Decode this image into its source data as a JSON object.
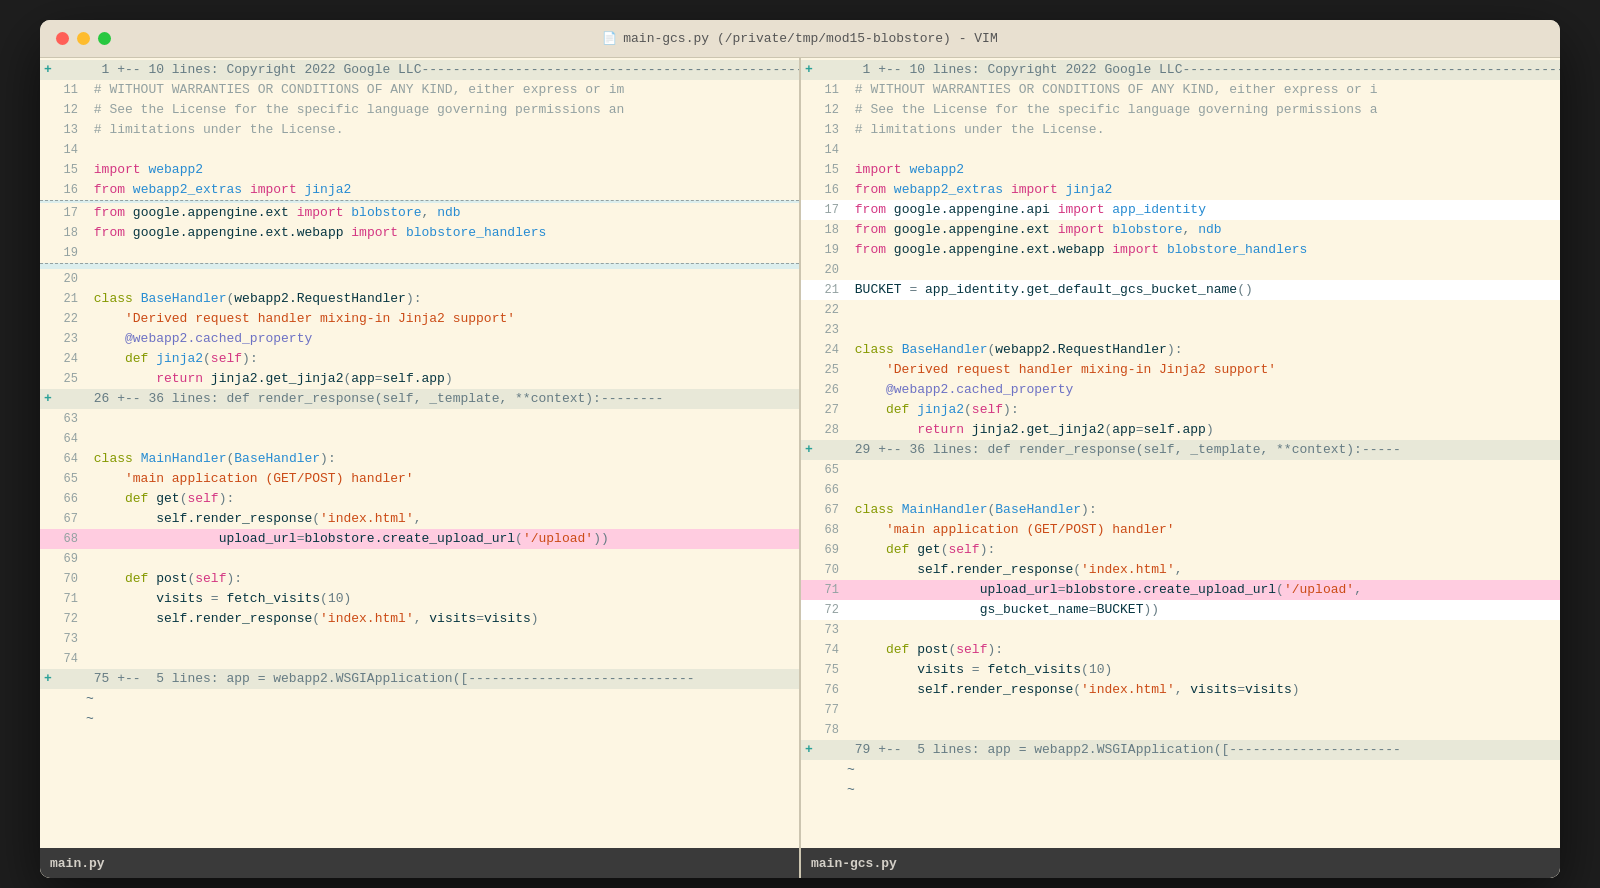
{
  "window": {
    "title": "main-gcs.py (/private/tmp/mod15-blobstore) - VIM",
    "title_icon": "📄"
  },
  "left_pane": {
    "statusbar_label": "main.py",
    "lines": [
      {
        "num": "",
        "fold": "+",
        "type": "fold",
        "content": "  1 +-- 10 lines: Copyright 2022 Google LLC------------------------------------------------------------"
      },
      {
        "num": "11",
        "fold": " ",
        "type": "comment",
        "content": " # WITHOUT WARRANTIES OR CONDITIONS OF ANY KIND, either express or im"
      },
      {
        "num": "12",
        "fold": " ",
        "type": "comment",
        "content": " # See the License for the specific language governing permissions an"
      },
      {
        "num": "13",
        "fold": " ",
        "type": "comment",
        "content": " # limitations under the License."
      },
      {
        "num": "14",
        "fold": " ",
        "type": "empty",
        "content": ""
      },
      {
        "num": "15",
        "fold": " ",
        "type": "normal",
        "content": " import webapp2"
      },
      {
        "num": "16",
        "fold": " ",
        "type": "normal",
        "content": " from webapp2_extras import jinja2"
      },
      {
        "num": "",
        "fold": " ",
        "type": "separator",
        "content": ""
      },
      {
        "num": "17",
        "fold": " ",
        "type": "normal",
        "content": " from google.appengine.ext import blobstore, ndb"
      },
      {
        "num": "18",
        "fold": " ",
        "type": "normal",
        "content": " from google.appengine.ext.webapp import blobstore_handlers"
      },
      {
        "num": "19",
        "fold": " ",
        "type": "empty",
        "content": ""
      },
      {
        "num": "",
        "fold": " ",
        "type": "separator",
        "content": ""
      },
      {
        "num": "",
        "fold": " ",
        "type": "separator2",
        "content": ""
      },
      {
        "num": "20",
        "fold": " ",
        "type": "empty",
        "content": ""
      },
      {
        "num": "21",
        "fold": " ",
        "type": "normal",
        "content": " class BaseHandler(webapp2.RequestHandler):"
      },
      {
        "num": "22",
        "fold": " ",
        "type": "normal",
        "content": "     'Derived request handler mixing-in Jinja2 support'"
      },
      {
        "num": "23",
        "fold": " ",
        "type": "normal",
        "content": "     @webapp2.cached_property"
      },
      {
        "num": "24",
        "fold": " ",
        "type": "normal",
        "content": "     def jinja2(self):"
      },
      {
        "num": "25",
        "fold": " ",
        "type": "normal",
        "content": "         return jinja2.get_jinja2(app=self.app)"
      },
      {
        "num": "",
        "fold": "+",
        "type": "fold",
        "content": " 26 +-- 36 lines: def render_response(self, _template, **context):--------"
      },
      {
        "num": "63",
        "fold": " ",
        "type": "empty",
        "content": ""
      },
      {
        "num": "64",
        "fold": " ",
        "type": "empty",
        "content": ""
      },
      {
        "num": "64",
        "fold": " ",
        "type": "normal",
        "content": " class MainHandler(BaseHandler):"
      },
      {
        "num": "65",
        "fold": " ",
        "type": "normal",
        "content": "     'main application (GET/POST) handler'"
      },
      {
        "num": "66",
        "fold": " ",
        "type": "normal",
        "content": "     def get(self):"
      },
      {
        "num": "67",
        "fold": " ",
        "type": "normal",
        "content": "         self.render_response('index.html',"
      },
      {
        "num": "68",
        "fold": " ",
        "type": "highlight_pink",
        "content": "                 upload_url=blobstore.create_upload_url('/upload'))"
      },
      {
        "num": "69",
        "fold": " ",
        "type": "empty",
        "content": ""
      },
      {
        "num": "70",
        "fold": " ",
        "type": "normal",
        "content": "     def post(self):"
      },
      {
        "num": "71",
        "fold": " ",
        "type": "normal",
        "content": "         visits = fetch_visits(10)"
      },
      {
        "num": "72",
        "fold": " ",
        "type": "normal",
        "content": "         self.render_response('index.html', visits=visits)"
      },
      {
        "num": "73",
        "fold": " ",
        "type": "empty",
        "content": ""
      },
      {
        "num": "74",
        "fold": " ",
        "type": "empty",
        "content": ""
      },
      {
        "num": "",
        "fold": "+",
        "type": "fold",
        "content": " 75 +--  5 lines: app = webapp2.WSGIApplication([-----------------------------"
      },
      {
        "num": "",
        "fold": " ",
        "type": "tilde",
        "content": "~"
      },
      {
        "num": "",
        "fold": " ",
        "type": "tilde",
        "content": "~"
      }
    ]
  },
  "right_pane": {
    "statusbar_label": "main-gcs.py",
    "lines": [
      {
        "num": "",
        "fold": "+",
        "type": "fold",
        "content": "  1 +-- 10 lines: Copyright 2022 Google LLC------------------------------------------------------------"
      },
      {
        "num": "11",
        "fold": " ",
        "type": "comment",
        "content": " # WITHOUT WARRANTIES OR CONDITIONS OF ANY KIND, either express or i"
      },
      {
        "num": "12",
        "fold": " ",
        "type": "comment",
        "content": " # See the License for the specific language governing permissions a"
      },
      {
        "num": "13",
        "fold": " ",
        "type": "comment",
        "content": " # limitations under the License."
      },
      {
        "num": "14",
        "fold": " ",
        "type": "empty",
        "content": ""
      },
      {
        "num": "15",
        "fold": " ",
        "type": "normal",
        "content": " import webapp2"
      },
      {
        "num": "16",
        "fold": " ",
        "type": "normal",
        "content": " from webapp2_extras import jinja2"
      },
      {
        "num": "17",
        "fold": " ",
        "type": "added_white",
        "content": " from google.appengine.api import app_identity"
      },
      {
        "num": "18",
        "fold": " ",
        "type": "normal",
        "content": " from google.appengine.ext import blobstore, ndb"
      },
      {
        "num": "19",
        "fold": " ",
        "type": "normal",
        "content": " from google.appengine.ext.webapp import blobstore_handlers"
      },
      {
        "num": "20",
        "fold": " ",
        "type": "empty",
        "content": ""
      },
      {
        "num": "21",
        "fold": " ",
        "type": "added_white",
        "content": " BUCKET = app_identity.get_default_gcs_bucket_name()"
      },
      {
        "num": "22",
        "fold": " ",
        "type": "empty",
        "content": ""
      },
      {
        "num": "23",
        "fold": " ",
        "type": "empty",
        "content": ""
      },
      {
        "num": "24",
        "fold": " ",
        "type": "normal",
        "content": " class BaseHandler(webapp2.RequestHandler):"
      },
      {
        "num": "25",
        "fold": " ",
        "type": "normal",
        "content": "     'Derived request handler mixing-in Jinja2 support'"
      },
      {
        "num": "26",
        "fold": " ",
        "type": "normal",
        "content": "     @webapp2.cached_property"
      },
      {
        "num": "27",
        "fold": " ",
        "type": "normal",
        "content": "     def jinja2(self):"
      },
      {
        "num": "28",
        "fold": " ",
        "type": "normal",
        "content": "         return jinja2.get_jinja2(app=self.app)"
      },
      {
        "num": "",
        "fold": "+",
        "type": "fold",
        "content": " 29 +-- 36 lines: def render_response(self, _template, **context):-----"
      },
      {
        "num": "65",
        "fold": " ",
        "type": "empty",
        "content": ""
      },
      {
        "num": "66",
        "fold": " ",
        "type": "empty",
        "content": ""
      },
      {
        "num": "67",
        "fold": " ",
        "type": "normal",
        "content": " class MainHandler(BaseHandler):"
      },
      {
        "num": "68",
        "fold": " ",
        "type": "normal",
        "content": "     'main application (GET/POST) handler'"
      },
      {
        "num": "69",
        "fold": " ",
        "type": "normal",
        "content": "     def get(self):"
      },
      {
        "num": "70",
        "fold": " ",
        "type": "normal",
        "content": "         self.render_response('index.html',"
      },
      {
        "num": "71",
        "fold": " ",
        "type": "highlight_pink",
        "content": "                 upload_url=blobstore.create_upload_url('/upload',"
      },
      {
        "num": "72",
        "fold": " ",
        "type": "added_white2",
        "content": "                 gs_bucket_name=BUCKET))"
      },
      {
        "num": "73",
        "fold": " ",
        "type": "empty",
        "content": ""
      },
      {
        "num": "74",
        "fold": " ",
        "type": "normal",
        "content": "     def post(self):"
      },
      {
        "num": "75",
        "fold": " ",
        "type": "normal",
        "content": "         visits = fetch_visits(10)"
      },
      {
        "num": "76",
        "fold": " ",
        "type": "normal",
        "content": "         self.render_response('index.html', visits=visits)"
      },
      {
        "num": "77",
        "fold": " ",
        "type": "empty",
        "content": ""
      },
      {
        "num": "78",
        "fold": " ",
        "type": "empty",
        "content": ""
      },
      {
        "num": "",
        "fold": "+",
        "type": "fold",
        "content": " 79 +--  5 lines: app = webapp2.WSGIApplication([----------------------"
      },
      {
        "num": "",
        "fold": " ",
        "type": "tilde",
        "content": "~"
      },
      {
        "num": "",
        "fold": " ",
        "type": "tilde",
        "content": "~"
      }
    ]
  }
}
